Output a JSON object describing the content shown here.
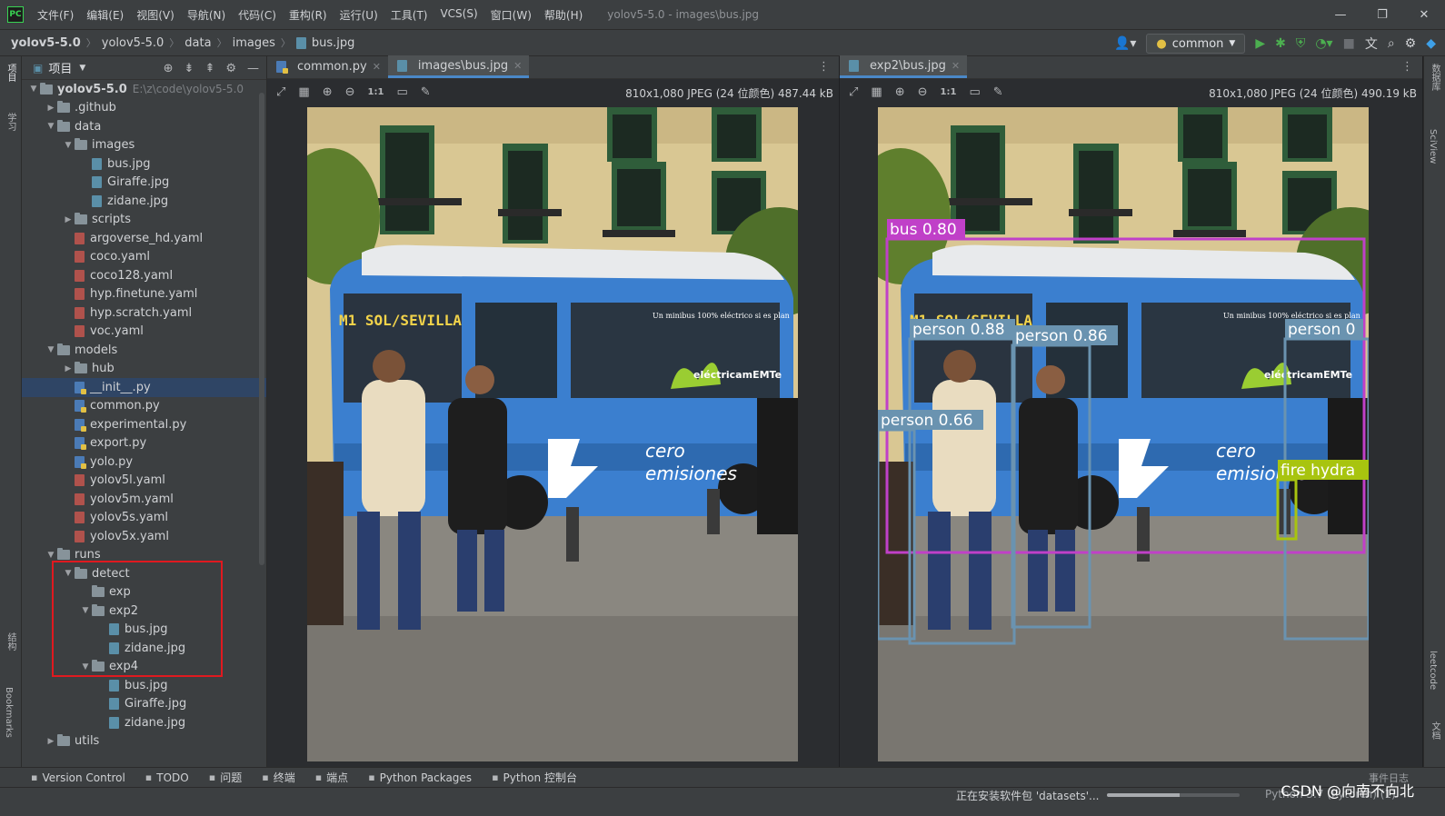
{
  "app": {
    "logo_text": "PC",
    "window_title": "yolov5-5.0 - images\\bus.jpg",
    "menu": [
      "文件(F)",
      "编辑(E)",
      "视图(V)",
      "导航(N)",
      "代码(C)",
      "重构(R)",
      "运行(U)",
      "工具(T)",
      "VCS(S)",
      "窗口(W)",
      "帮助(H)"
    ]
  },
  "breadcrumb": [
    "yolov5-5.0",
    "yolov5-5.0",
    "data",
    "images",
    "bus.jpg"
  ],
  "run_config": {
    "label": "common"
  },
  "left_strip": {
    "project_tab": "项目",
    "learn_tab": "学习",
    "structure_tab": "结构",
    "bookmarks_tab": "Bookmarks"
  },
  "right_strip": {
    "db_tab": "数据库",
    "sciview_tab": "SciView",
    "leetcode_tab": "leetcode",
    "doc_tab": "文档"
  },
  "project_panel": {
    "title": "项目",
    "root_name": "yolov5-5.0",
    "root_path": "E:\\z\\code\\yolov5-5.0",
    "tree": [
      {
        "label": "yolov5-5.0",
        "depth": 1,
        "type": "folder",
        "open": true
      },
      {
        "label": ".github",
        "depth": 2,
        "type": "folder",
        "open": false
      },
      {
        "label": "data",
        "depth": 2,
        "type": "folder",
        "open": true
      },
      {
        "label": "images",
        "depth": 3,
        "type": "folder",
        "open": true
      },
      {
        "label": "bus.jpg",
        "depth": 4,
        "type": "img"
      },
      {
        "label": "Giraffe.jpg",
        "depth": 4,
        "type": "img"
      },
      {
        "label": "zidane.jpg",
        "depth": 4,
        "type": "img"
      },
      {
        "label": "scripts",
        "depth": 3,
        "type": "folder",
        "open": false
      },
      {
        "label": "argoverse_hd.yaml",
        "depth": 3,
        "type": "yaml"
      },
      {
        "label": "coco.yaml",
        "depth": 3,
        "type": "yaml"
      },
      {
        "label": "coco128.yaml",
        "depth": 3,
        "type": "yaml"
      },
      {
        "label": "hyp.finetune.yaml",
        "depth": 3,
        "type": "yaml"
      },
      {
        "label": "hyp.scratch.yaml",
        "depth": 3,
        "type": "yaml"
      },
      {
        "label": "voc.yaml",
        "depth": 3,
        "type": "yaml"
      },
      {
        "label": "models",
        "depth": 2,
        "type": "folder",
        "open": true
      },
      {
        "label": "hub",
        "depth": 3,
        "type": "folder",
        "open": false
      },
      {
        "label": "__init__.py",
        "depth": 3,
        "type": "py",
        "selected": true
      },
      {
        "label": "common.py",
        "depth": 3,
        "type": "py"
      },
      {
        "label": "experimental.py",
        "depth": 3,
        "type": "py"
      },
      {
        "label": "export.py",
        "depth": 3,
        "type": "py"
      },
      {
        "label": "yolo.py",
        "depth": 3,
        "type": "py"
      },
      {
        "label": "yolov5l.yaml",
        "depth": 3,
        "type": "yaml"
      },
      {
        "label": "yolov5m.yaml",
        "depth": 3,
        "type": "yaml"
      },
      {
        "label": "yolov5s.yaml",
        "depth": 3,
        "type": "yaml"
      },
      {
        "label": "yolov5x.yaml",
        "depth": 3,
        "type": "yaml"
      },
      {
        "label": "runs",
        "depth": 2,
        "type": "folder",
        "open": true
      },
      {
        "label": "detect",
        "depth": 3,
        "type": "folder",
        "open": true
      },
      {
        "label": "exp",
        "depth": 4,
        "type": "folder",
        "leaf": true
      },
      {
        "label": "exp2",
        "depth": 4,
        "type": "folder",
        "open": true
      },
      {
        "label": "bus.jpg",
        "depth": 5,
        "type": "img"
      },
      {
        "label": "zidane.jpg",
        "depth": 5,
        "type": "img"
      },
      {
        "label": "exp4",
        "depth": 4,
        "type": "folder",
        "open": true
      },
      {
        "label": "bus.jpg",
        "depth": 5,
        "type": "img"
      },
      {
        "label": "Giraffe.jpg",
        "depth": 5,
        "type": "img"
      },
      {
        "label": "zidane.jpg",
        "depth": 5,
        "type": "img"
      },
      {
        "label": "utils",
        "depth": 2,
        "type": "folder",
        "open": false
      }
    ]
  },
  "editor_left": {
    "tabs": [
      {
        "label": "common.py",
        "active": false
      },
      {
        "label": "images\\bus.jpg",
        "active": true
      }
    ],
    "image_info": "810x1,080 JPEG (24 位颜色) 487.44 kB"
  },
  "editor_right": {
    "tabs": [
      {
        "label": "exp2\\bus.jpg",
        "active": true
      }
    ],
    "image_info": "810x1,080 JPEG (24 位颜色) 490.19 kB",
    "detections": [
      {
        "label": "bus 0.80",
        "color": "#c040c8"
      },
      {
        "label": "person 0.88",
        "color": "#6a93b0"
      },
      {
        "label": "person 0.86",
        "color": "#6a93b0"
      },
      {
        "label": "person 0",
        "color": "#6a93b0"
      },
      {
        "label": "person 0.66",
        "color": "#6a93b0"
      },
      {
        "label": "fire hydra",
        "color": "#a8c40f"
      }
    ]
  },
  "bus_text": {
    "destination": "M1 SOL/SEVILLA",
    "slogan": "Un minibus 100% eléctrico si es plan",
    "brand": "eléctricamEMTe",
    "emisiones_1": "cero",
    "emisiones_2": "emisiones"
  },
  "tool_windows": [
    {
      "label": "Version Control",
      "icon": "branch-icon"
    },
    {
      "label": "TODO",
      "icon": "list-icon"
    },
    {
      "label": "问题",
      "icon": "problems-icon"
    },
    {
      "label": "终端",
      "icon": "terminal-icon"
    },
    {
      "label": "端点",
      "icon": "endpoints-icon"
    },
    {
      "label": "Python Packages",
      "icon": "packages-icon"
    },
    {
      "label": "Python 控制台",
      "icon": "python-console-icon"
    }
  ],
  "event_log": "事件日志",
  "status": {
    "text": "正在安装软件包 'datasets'...",
    "progress": 0.55,
    "interpreter": "Python 3.7 (Pytorch) (1)"
  },
  "watermark": "CSDN @向南不向北"
}
